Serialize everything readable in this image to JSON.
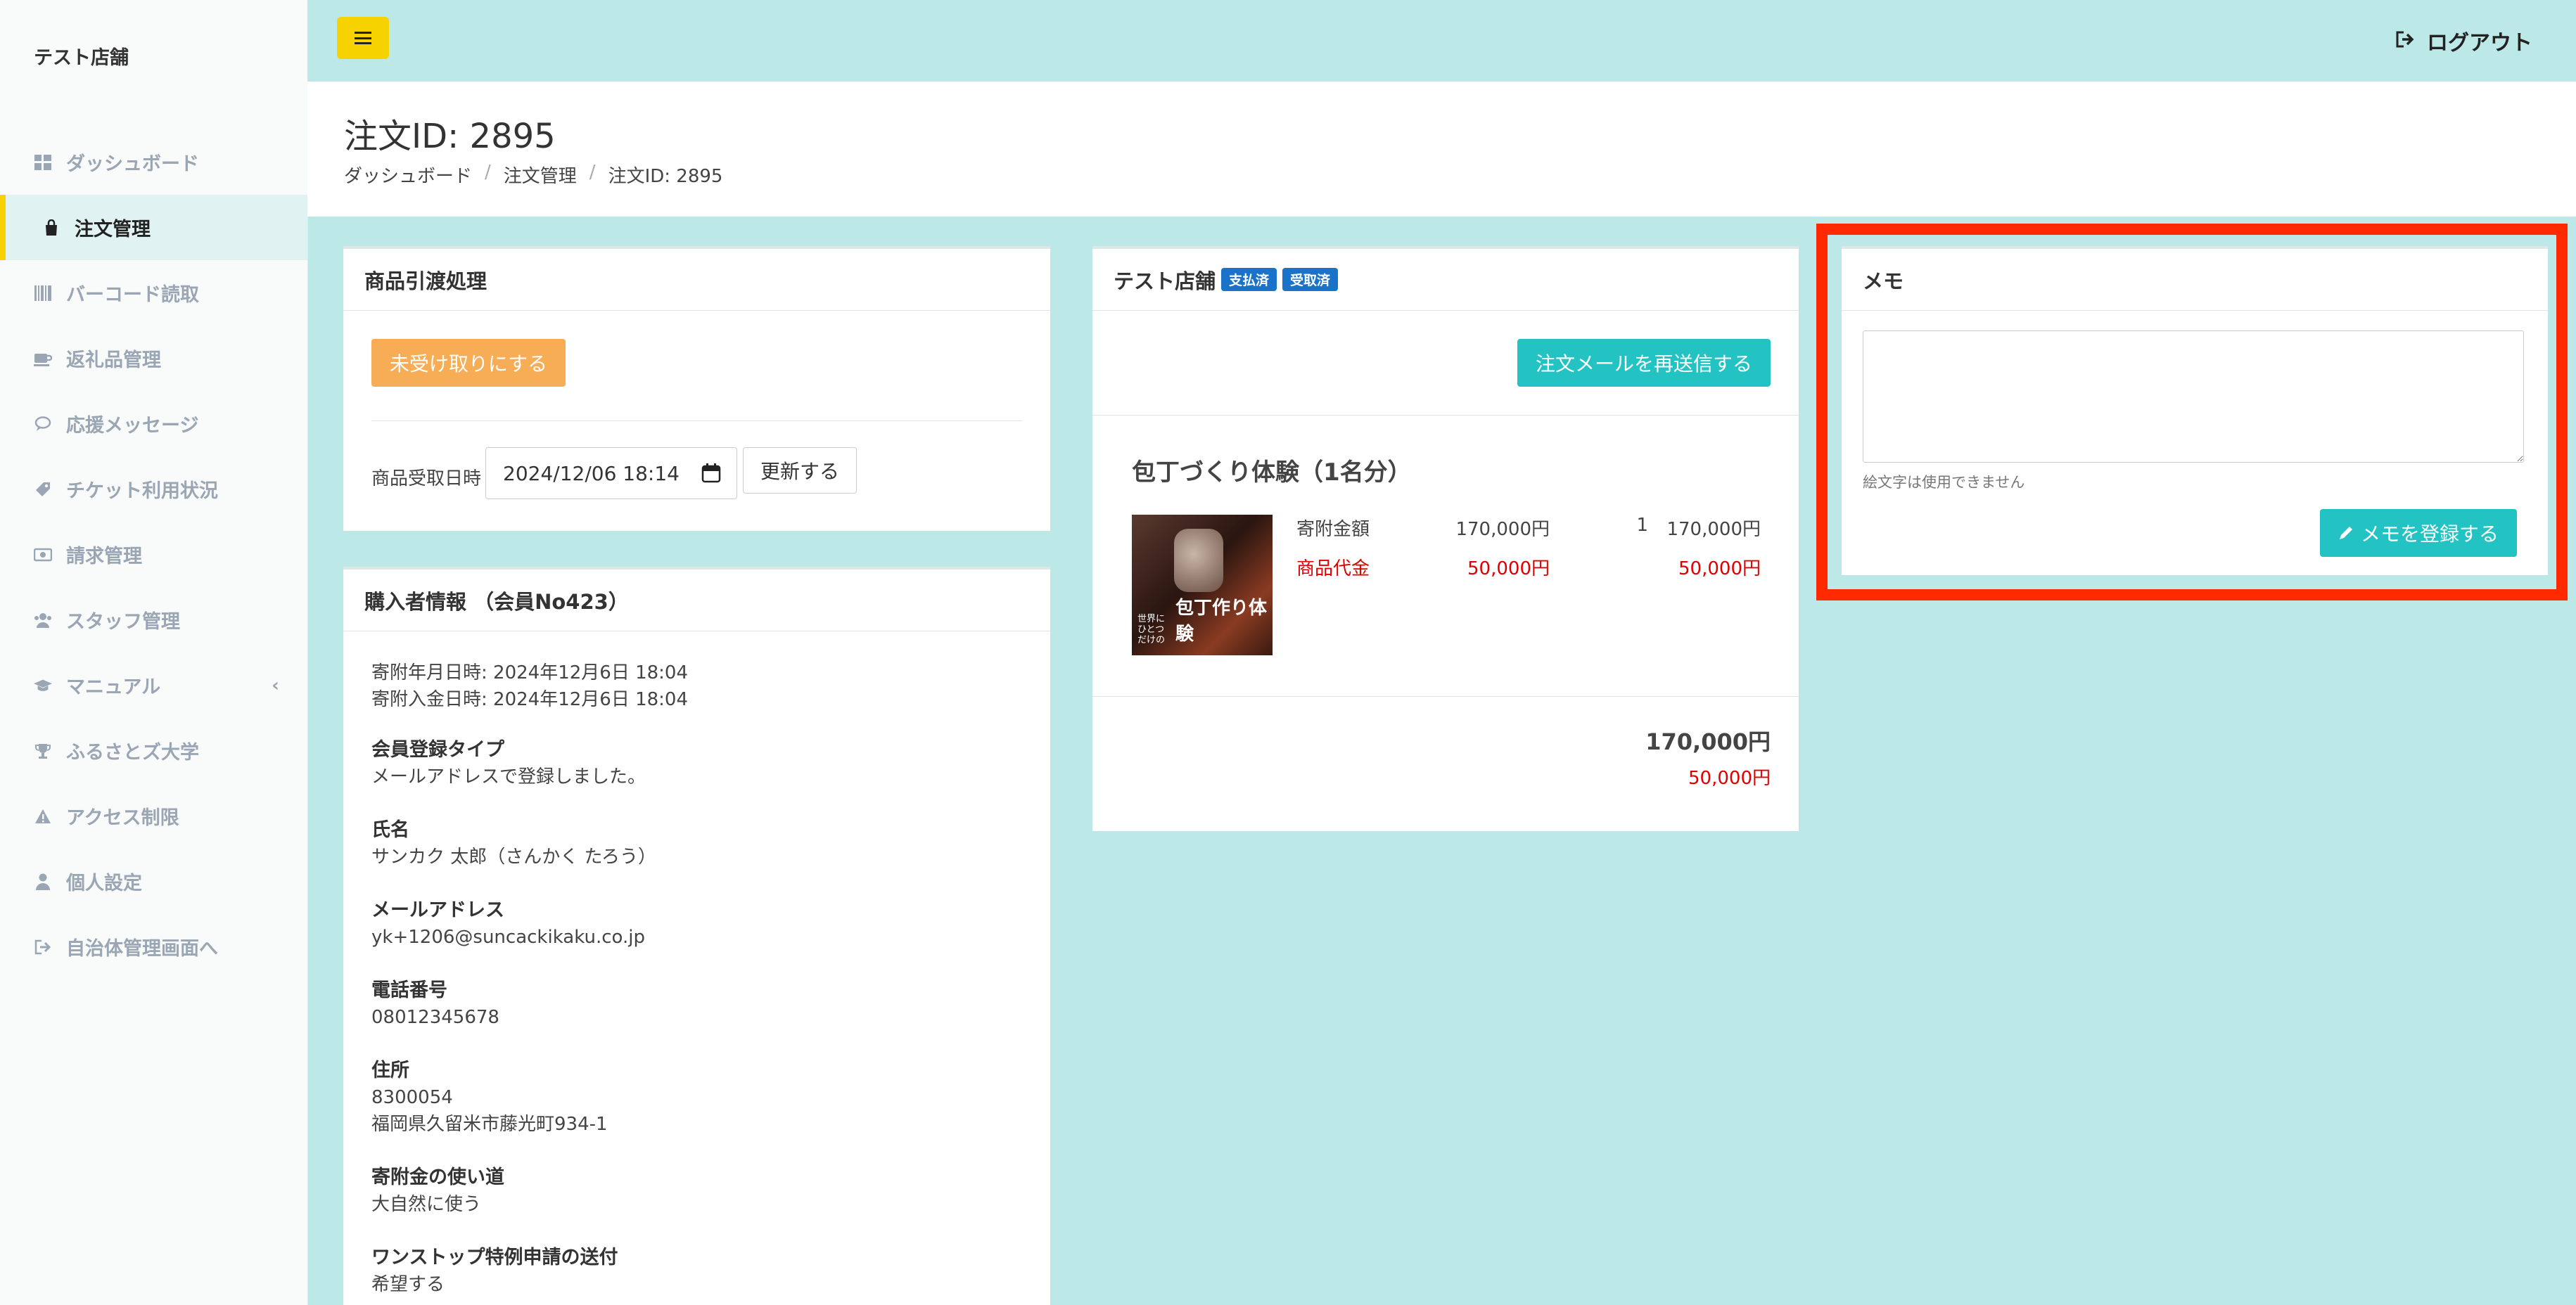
{
  "sidebar": {
    "brand": "テスト店舗",
    "items": [
      {
        "label": "ダッシュボード",
        "icon": "dashboard-icon"
      },
      {
        "label": "注文管理",
        "icon": "shopping-bag-icon",
        "active": true
      },
      {
        "label": "バーコード読取",
        "icon": "barcode-icon"
      },
      {
        "label": "返礼品管理",
        "icon": "gift-icon"
      },
      {
        "label": "応援メッセージ",
        "icon": "comment-icon"
      },
      {
        "label": "チケット利用状況",
        "icon": "ticket-icon"
      },
      {
        "label": "請求管理",
        "icon": "money-icon"
      },
      {
        "label": "スタッフ管理",
        "icon": "users-icon"
      },
      {
        "label": "マニュアル",
        "icon": "graduation-cap-icon"
      },
      {
        "label": "ふるさとズ大学",
        "icon": "trophy-icon"
      },
      {
        "label": "アクセス制限",
        "icon": "warning-icon"
      },
      {
        "label": "個人設定",
        "icon": "user-icon"
      },
      {
        "label": "自治体管理画面へ",
        "icon": "sign-out-icon"
      }
    ]
  },
  "topbar": {
    "logout_label": "ログアウト"
  },
  "header": {
    "title": "注文ID: 2895",
    "breadcrumb": [
      "ダッシュボード",
      "注文管理",
      "注文ID: 2895"
    ]
  },
  "delivery_panel": {
    "title": "商品引渡処理",
    "unreceived_button": "未受け取りにする",
    "received_label": "商品受取日時",
    "received_value": "2024/12/06 18:14",
    "update_button": "更新する"
  },
  "buyer_panel": {
    "title": "購入者情報 （会員No423）",
    "donation_datetime": "寄附年月日時: 2024年12月6日 18:04",
    "payment_datetime": "寄附入金日時: 2024年12月6日 18:04",
    "fields": [
      {
        "label": "会員登録タイプ",
        "value": "メールアドレスで登録しました。"
      },
      {
        "label": "氏名",
        "value": "サンカク 太郎（さんかく たろう）"
      },
      {
        "label": "メールアドレス",
        "value": "yk+1206@suncackikaku.co.jp"
      },
      {
        "label": "電話番号",
        "value": "08012345678"
      },
      {
        "label": "住所",
        "value": "8300054",
        "value2": "福岡県久留米市藤光町934-1"
      },
      {
        "label": "寄附金の使い道",
        "value": "大自然に使う"
      },
      {
        "label": "ワンストップ特例申請の送付",
        "value": "希望する"
      }
    ]
  },
  "order_panel": {
    "store": "テスト店舗",
    "badges": [
      "支払済",
      "受取済"
    ],
    "resend_button": "注文メールを再送信する",
    "product_name": "包丁づくり体験（1名分）",
    "thumb_caption_small": "世界に ひとつだけの",
    "thumb_caption_large": "包丁作り体験",
    "rows": [
      {
        "label": "寄附金額",
        "price": "170,000円",
        "qty": "1",
        "total": "170,000円"
      },
      {
        "label": "商品代金",
        "price": "50,000円",
        "qty": "",
        "total": "50,000円"
      }
    ],
    "sum_total": "170,000円",
    "sum_product": "50,000円"
  },
  "memo_panel": {
    "title": "メモ",
    "placeholder": "",
    "note": "絵文字は使用できません",
    "register_button": "メモを登録する"
  },
  "colors": {
    "accent_yellow": "#f5d200",
    "teal_bg": "#bde8e8",
    "teal_button": "#24c3c3",
    "orange_button": "#f6ad55",
    "badge_blue": "#1a73c9",
    "red_text": "#e00000",
    "highlight_red": "#ff2a00"
  }
}
